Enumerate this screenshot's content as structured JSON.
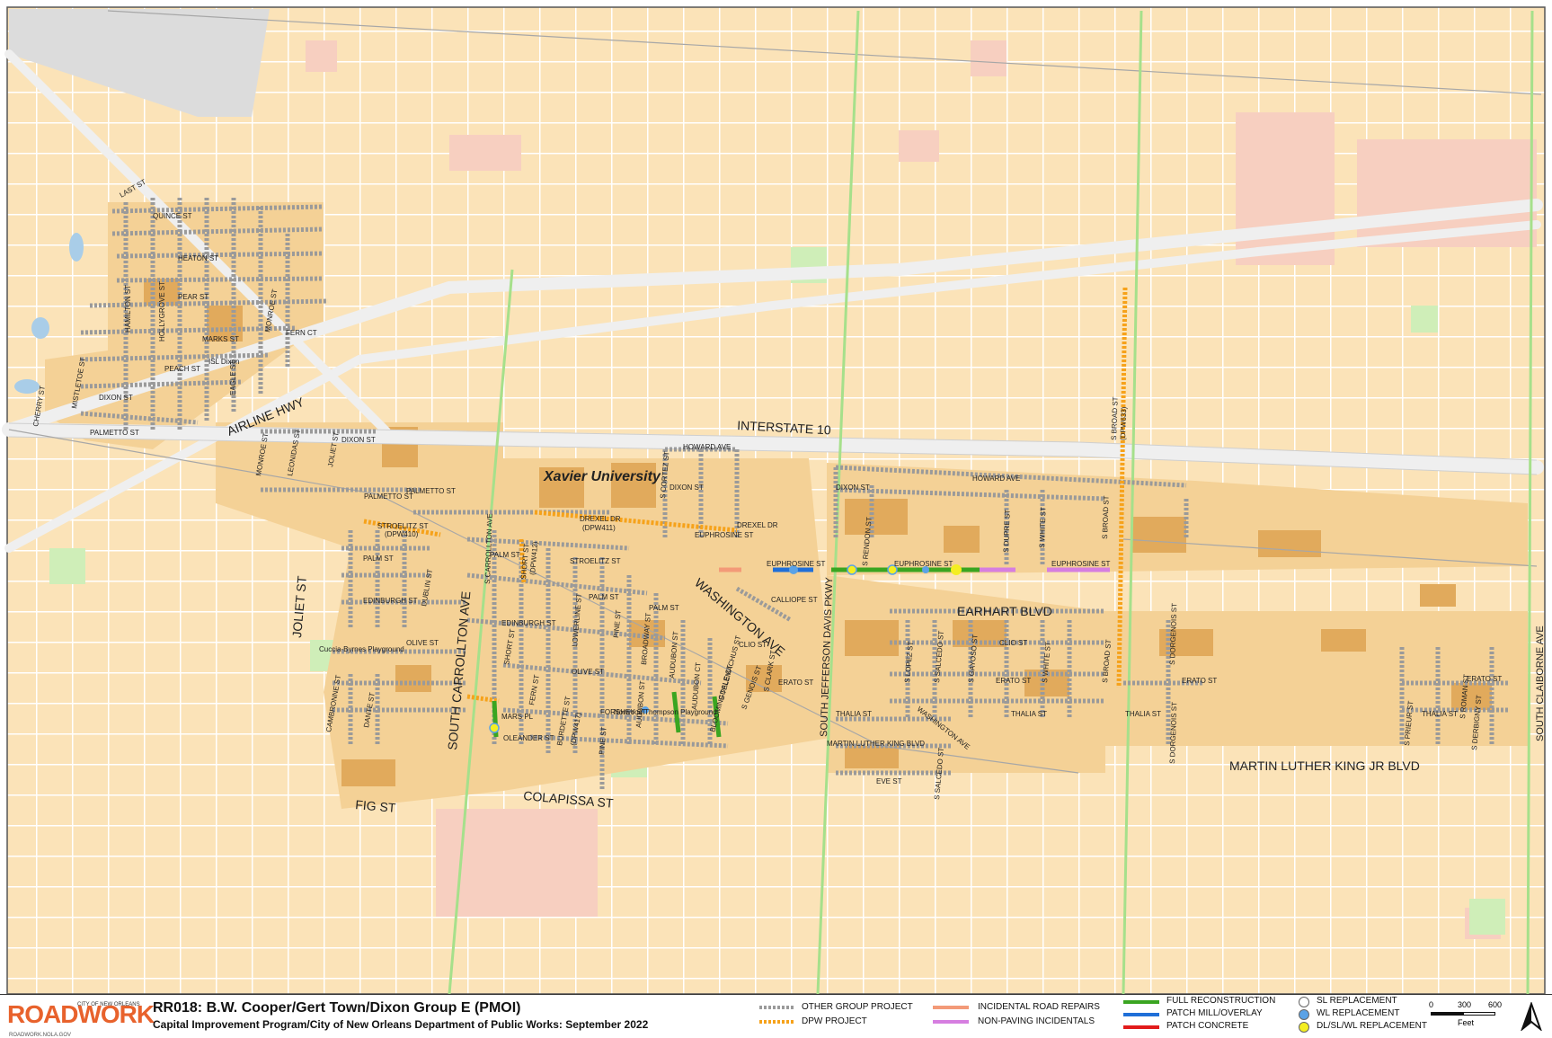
{
  "map": {
    "streets": {
      "last": "LAST ST",
      "quince": "QUINCE ST",
      "heaton": "HEATON ST",
      "pear": "PEAR ST",
      "marks": "MARKS ST",
      "peach": "PEACH ST",
      "dixon_w": "DIXON ST",
      "palmetto_w": "PALMETTO ST",
      "cherry": "CHERRY ST",
      "mistletoe": "MISTLETOE ST",
      "hamilton": "HAMILTON ST",
      "hollygrove": "HOLLYGROVE ST",
      "eagle": "EAGLE ST",
      "monroe": "MONROE ST",
      "fern_ct": "FERN CT",
      "isl_dixon": "ISL Dixon",
      "airline": "AIRLINE HWY",
      "interstate": "INTERSTATE 10",
      "monroe_s": "MONROE ST",
      "leonidas": "LEONIDAS ST",
      "joliet_n": "JOLIET ST",
      "dixon_c": "DIXON ST",
      "palmetto_c": "PALMETTO ST",
      "palmetto_c2": "PALMETTO ST",
      "stroelitz_w": "STROELITZ ST",
      "dpw410": "(DPW410)",
      "palm_w": "PALM ST",
      "edinburgh_w": "EDINBURGH ST",
      "dublin": "DUBLIN ST",
      "olive_w": "OLIVE ST",
      "joliet": "JOLIET ST",
      "cuccia": "Cuccia-Byrnes Playground",
      "cambronne": "CAMBRONNE ST",
      "dante": "DANTE ST",
      "fig": "FIG ST",
      "s_carrollton": "SOUTH CARROLLTON AVE",
      "s_carrollton_ave": "S CARROLLTON AVE",
      "short": "SHORT ST",
      "dpw412": "(DPW412)",
      "palm_c": "PALM ST",
      "stroelitz_c": "STROELITZ ST",
      "edinburgh_c": "EDINBURGH ST",
      "short_s": "SHORT ST",
      "fern": "FERN ST",
      "mars": "MARS PL",
      "oleander": "OLEANDER ST",
      "burdette": "BURDETTE ST",
      "dpw417": "(DPW417)",
      "lowerline": "LOWERLINE ST",
      "pine": "PINE ST",
      "pine_s": "PINE ST",
      "broadway": "BROADWAY ST",
      "olive_c": "OLIVE ST",
      "palm_c2": "PALM ST",
      "palm_c3": "PALM ST",
      "forshey": "FORSHEY ST",
      "colapissa": "COLAPISSA ST",
      "norwood": "Norwood Thompson Playground",
      "audubon": "AUDUBON ST",
      "audubon_s": "AUDUBON ST",
      "audubon_ct": "AUDUBON CT",
      "bloomingdale": "BLOOMINGDALE CT",
      "s_telemachus": "S TELEMACHUS ST",
      "s_genois": "S GENOIS ST",
      "clio_w": "CLIO ST",
      "s_clark": "S CLARK ST",
      "erato_w": "ERATO ST",
      "xavier": "Xavier University",
      "s_cortez": "S CORTEZ ST",
      "howard_w": "HOWARD AVE",
      "dixon_x": "DIXON ST",
      "drexel": "DREXEL DR",
      "dpw411": "(DPW411)",
      "drexel_e": "DREXEL DR",
      "euphrosine_w": "EUPHROSINE ST",
      "euphrosine_c": "EUPHROSINE ST",
      "calliope": "CALLIOPE ST",
      "washington": "WASHINGTON AVE",
      "s_jeff_davis": "SOUTH JEFFERSON DAVIS PKWY",
      "dixon_e": "DIXON ST",
      "howard_e": "HOWARD AVE",
      "s_rendon": "S RENDON ST",
      "euphrosine_e": "EUPHROSINE ST",
      "s_dupre": "S DUPRE ST",
      "s_white": "S WHITE ST",
      "euphrosine_e2": "EUPHROSINE ST",
      "s_broad_dpw": "S BROAD ST",
      "dpw633": "(DPW633)",
      "s_broad": "S BROAD ST",
      "earhart": "EARHART BLVD",
      "s_lopez": "S LOPEZ ST",
      "s_salcedo": "S SALCEDO ST",
      "s_gayoso": "S GAYOSO ST",
      "clio_e": "CLIO ST",
      "erato_e": "ERATO ST",
      "s_white2": "S WHITE ST",
      "s_broad2": "S BROAD ST",
      "thalia_e": "THALIA ST",
      "washington_e": "WASHINGTON AVE",
      "thalia_w": "THALIA ST",
      "mlk": "MARTIN LUTHER KING BLVD",
      "eve": "EVE ST",
      "s_salcedo2": "S SALCEDO ST",
      "s_dorgenois": "S DORGENOIS ST",
      "s_dorgenois2": "S DORGENOIS ST",
      "erato_far": "ERATO ST",
      "thalia_far": "THALIA ST",
      "mlk_jr": "MARTIN LUTHER KING JR BLVD",
      "s_prieur": "S PRIEUR ST",
      "s_roman": "S ROMAN ST",
      "thalia_far2": "THALIA ST",
      "s_derbigny": "S DERBIGNY ST",
      "erato_far2": "ERATO ST",
      "s_claiborne": "SOUTH CLAIBORNE AVE"
    }
  },
  "footer": {
    "logo_road": "ROAD",
    "logo_work": "WORK",
    "logo_city": "CITY OF NEW ORLEANS",
    "logo_url": "ROADWORK.NOLA.GOV",
    "title": "RR018:  B.W. Cooper/Gert Town/Dixon Group E (PMOI)",
    "subtitle": "Capital Improvement Program/City of New Orleans Department of Public Works:  September 2022"
  },
  "legend": {
    "other_group": "OTHER GROUP PROJECT",
    "dpw_project": "DPW PROJECT",
    "incidental_road": "INCIDENTAL ROAD REPAIRS",
    "non_paving": "NON-PAVING INCIDENTALS",
    "full_recon": "FULL RECONSTRUCTION",
    "patch_mill": "PATCH MILL/OVERLAY",
    "patch_concrete": "PATCH CONCRETE",
    "sl_replacement": "SL REPLACEMENT",
    "wl_replacement": "WL REPLACEMENT",
    "dl_sl_wl": "DL/SL/WL REPLACEMENT",
    "scale_0": "0",
    "scale_300": "300",
    "scale_600": "600",
    "scale_unit": "Feet"
  },
  "colors": {
    "land": "#fbe3b8",
    "block": "#f0c47e",
    "building": "#e1aa5c",
    "street": "#ffffff",
    "highway": "#eeeeee",
    "park": "#cfeeb8",
    "pink": "#f7cfc0",
    "other_group": "#9a9a9a",
    "dpw": "#f6a21a",
    "incidental": "#f39a78",
    "non_paving": "#d67ee0",
    "full_recon": "#3aa521",
    "patch_mill": "#1f6fd8",
    "patch_concrete": "#e21b1b",
    "sl": "#ffffff",
    "wl": "#5aa2e6",
    "dl": "#f4ee22"
  }
}
